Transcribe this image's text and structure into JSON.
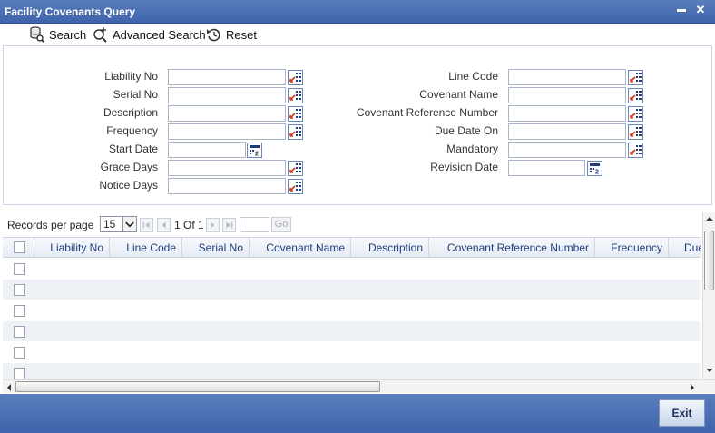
{
  "window": {
    "title": "Facility Covenants Query",
    "minimize_glyph": "▬",
    "close_glyph": "✕"
  },
  "toolbar": {
    "search_label": "Search",
    "advanced_search_label": "Advanced Search",
    "reset_label": "Reset"
  },
  "form": {
    "left": [
      {
        "label": "Liability No",
        "value": "",
        "control": "lov"
      },
      {
        "label": "Serial No",
        "value": "",
        "control": "lov"
      },
      {
        "label": "Description",
        "value": "",
        "control": "lov"
      },
      {
        "label": "Frequency",
        "value": "",
        "control": "lov"
      },
      {
        "label": "Start Date",
        "value": "",
        "control": "calendar"
      },
      {
        "label": "Grace Days",
        "value": "",
        "control": "lov"
      },
      {
        "label": "Notice Days",
        "value": "",
        "control": "lov"
      }
    ],
    "right": [
      {
        "label": "Line Code",
        "value": "",
        "control": "lov"
      },
      {
        "label": "Covenant Name",
        "value": "",
        "control": "lov"
      },
      {
        "label": "Covenant Reference Number",
        "value": "",
        "control": "lov"
      },
      {
        "label": "Due Date On",
        "value": "",
        "control": "lov"
      },
      {
        "label": "Mandatory",
        "value": "",
        "control": "lov"
      },
      {
        "label": "Revision Date",
        "value": "",
        "control": "calendar"
      }
    ]
  },
  "pager": {
    "records_label": "Records per page",
    "per_page": "15",
    "page_text": "1 Of 1",
    "page_input": "",
    "go_label": "Go"
  },
  "grid": {
    "columns": [
      "Liability No",
      "Line Code",
      "Serial No",
      "Covenant Name",
      "Description",
      "Covenant Reference Number",
      "Frequency",
      "Due"
    ],
    "row_count": 6
  },
  "footer": {
    "exit_label": "Exit"
  },
  "colors": {
    "titlebar": "#4a6db3",
    "header_text": "#1f3c7a",
    "row_alt": "#eef1f6"
  }
}
